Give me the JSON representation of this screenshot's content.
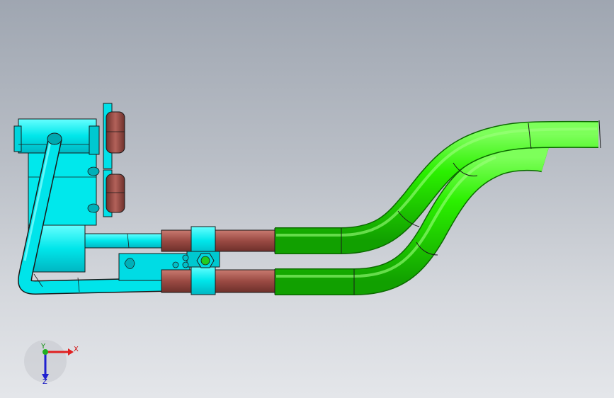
{
  "viewport": {
    "background_top": "#9fa6b1",
    "background_bottom": "#e4e6ea"
  },
  "model": {
    "colors": {
      "cyan_body": "#00e8e8",
      "cyan_shade": "#00b8c0",
      "copper": "#a0524a",
      "copper_dark": "#6e2f2a",
      "green_pipe": "#22ee00",
      "green_shade": "#12a800",
      "edge": "#1a1a1a"
    },
    "parts": [
      "valve-block",
      "elbow-tube",
      "copper-couplings",
      "pipe-clamp",
      "hex-nut",
      "green-bent-pipe-upper",
      "green-bent-pipe-lower"
    ]
  },
  "triad": {
    "x_label": "X",
    "y_label": "Y",
    "z_label": "Z",
    "x_color": "#e02020",
    "y_color": "#20b020",
    "z_color": "#2020d0"
  }
}
